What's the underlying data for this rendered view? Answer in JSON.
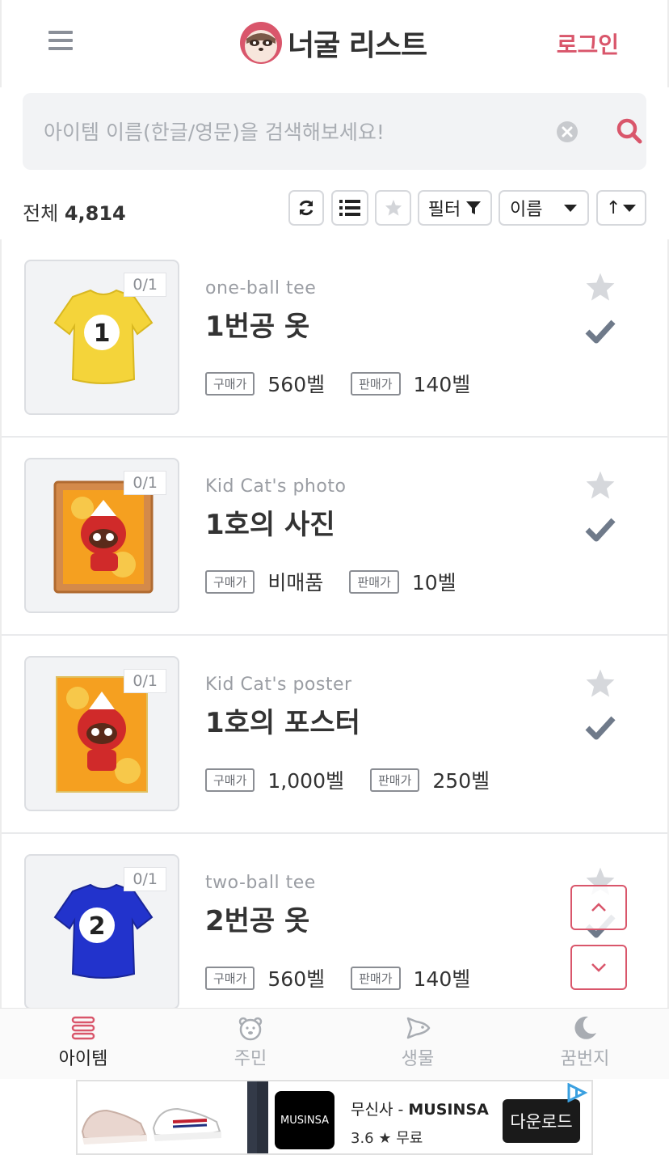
{
  "header": {
    "logo_text": "너굴 리스트",
    "login_label": "로그인"
  },
  "search": {
    "placeholder": "아이템 이름(한글/영문)을 검색해보세요!"
  },
  "toolbar": {
    "total_label": "전체",
    "total_count": "4,814",
    "filter_label": "필터",
    "sort_label": "이름",
    "order_label": "↑"
  },
  "items": [
    {
      "count": "0/1",
      "name_en": "one-ball tee",
      "name_ko": "1번공 옷",
      "buy_label": "구매가",
      "buy_price": "560벨",
      "sell_label": "판매가",
      "sell_price": "140벨"
    },
    {
      "count": "0/1",
      "name_en": "Kid Cat's photo",
      "name_ko": "1호의 사진",
      "buy_label": "구매가",
      "buy_price": "비매품",
      "sell_label": "판매가",
      "sell_price": "10벨"
    },
    {
      "count": "0/1",
      "name_en": "Kid Cat's poster",
      "name_ko": "1호의 포스터",
      "buy_label": "구매가",
      "buy_price": "1,000벨",
      "sell_label": "판매가",
      "sell_price": "250벨"
    },
    {
      "count": "0/1",
      "name_en": "two-ball tee",
      "name_ko": "2번공 옷",
      "buy_label": "구매가",
      "buy_price": "560벨",
      "sell_label": "판매가",
      "sell_price": "140벨"
    }
  ],
  "nav": [
    {
      "label": "아이템",
      "icon": "items-icon",
      "active": true
    },
    {
      "label": "주민",
      "icon": "villager-icon",
      "active": false
    },
    {
      "label": "생물",
      "icon": "fish-icon",
      "active": false
    },
    {
      "label": "꿈번지",
      "icon": "moon-icon",
      "active": false
    }
  ],
  "ad": {
    "logo_text": "MUSINSA",
    "brand_prefix": "무신사 - ",
    "brand_name": "MUSINSA",
    "rating": "3.6 ★ 무료",
    "cta": "다운로드"
  },
  "colors": {
    "accent": "#d9566b",
    "text": "#333333",
    "muted": "#9a9da3",
    "panel": "#f2f3f5"
  }
}
